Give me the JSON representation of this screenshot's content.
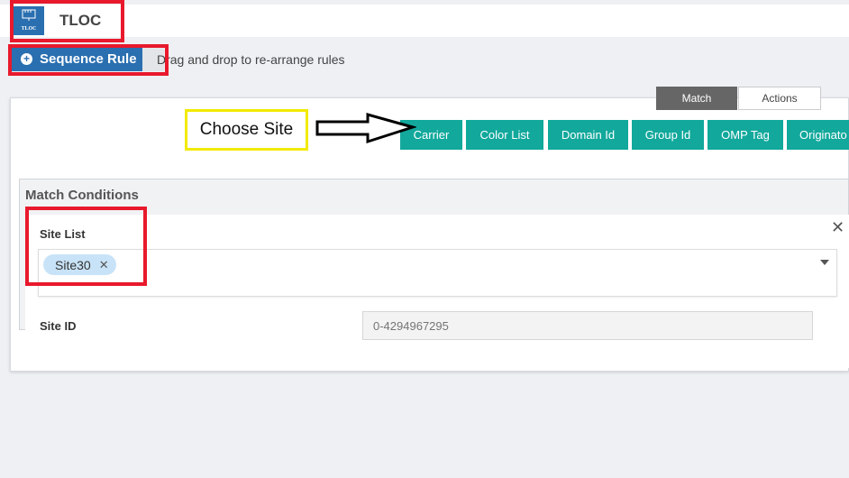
{
  "header": {
    "icon_label": "TLOC",
    "title": "TLOC"
  },
  "sequence": {
    "button_label": "Sequence Rule",
    "hint": "Drag and drop to re-arrange rules"
  },
  "tabs": [
    {
      "label": "Match",
      "active": true
    },
    {
      "label": "Actions",
      "active": false
    }
  ],
  "annotation": {
    "text": "Choose Site"
  },
  "match_buttons": [
    "Carrier",
    "Color List",
    "Domain Id",
    "Group Id",
    "OMP Tag",
    "Originato"
  ],
  "match_conditions": {
    "title": "Match Conditions",
    "site_list": {
      "label": "Site List",
      "selected": [
        "Site30"
      ]
    },
    "site_id": {
      "label": "Site ID",
      "placeholder": "0-4294967295"
    }
  },
  "colors": {
    "primary": "#2a6fb0",
    "teal": "#12a89c",
    "highlight_red": "#e8192c",
    "highlight_yellow": "#f2ea00"
  }
}
